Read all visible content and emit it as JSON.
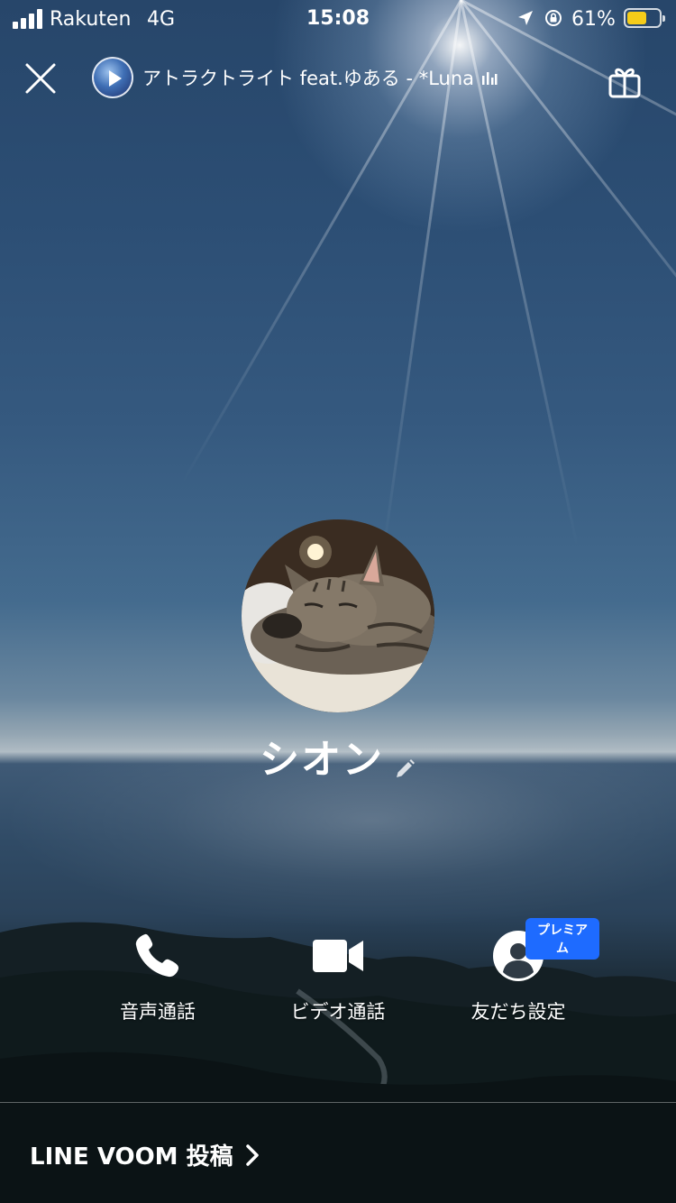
{
  "status_bar": {
    "carrier": "Rakuten",
    "network": "4G",
    "time": "15:08",
    "battery_percent_text": "61%",
    "battery_level": 0.61,
    "battery_color": "#f5cc19"
  },
  "top_bar": {
    "close_icon": "close-icon",
    "music_title": "アトラクトライト feat.ゆある - *Luna",
    "gift_icon": "gift-icon"
  },
  "profile": {
    "name": "シオン",
    "edit_icon": "pencil-icon"
  },
  "actions": [
    {
      "label": "音声通話",
      "icon": "phone-icon"
    },
    {
      "label": "ビデオ通話",
      "icon": "video-camera-icon"
    },
    {
      "label": "友だち設定",
      "icon": "user-icon",
      "badge": "プレミアム",
      "badge_color": "#1e6bff"
    }
  ],
  "voom": {
    "label": "LINE VOOM 投稿"
  }
}
